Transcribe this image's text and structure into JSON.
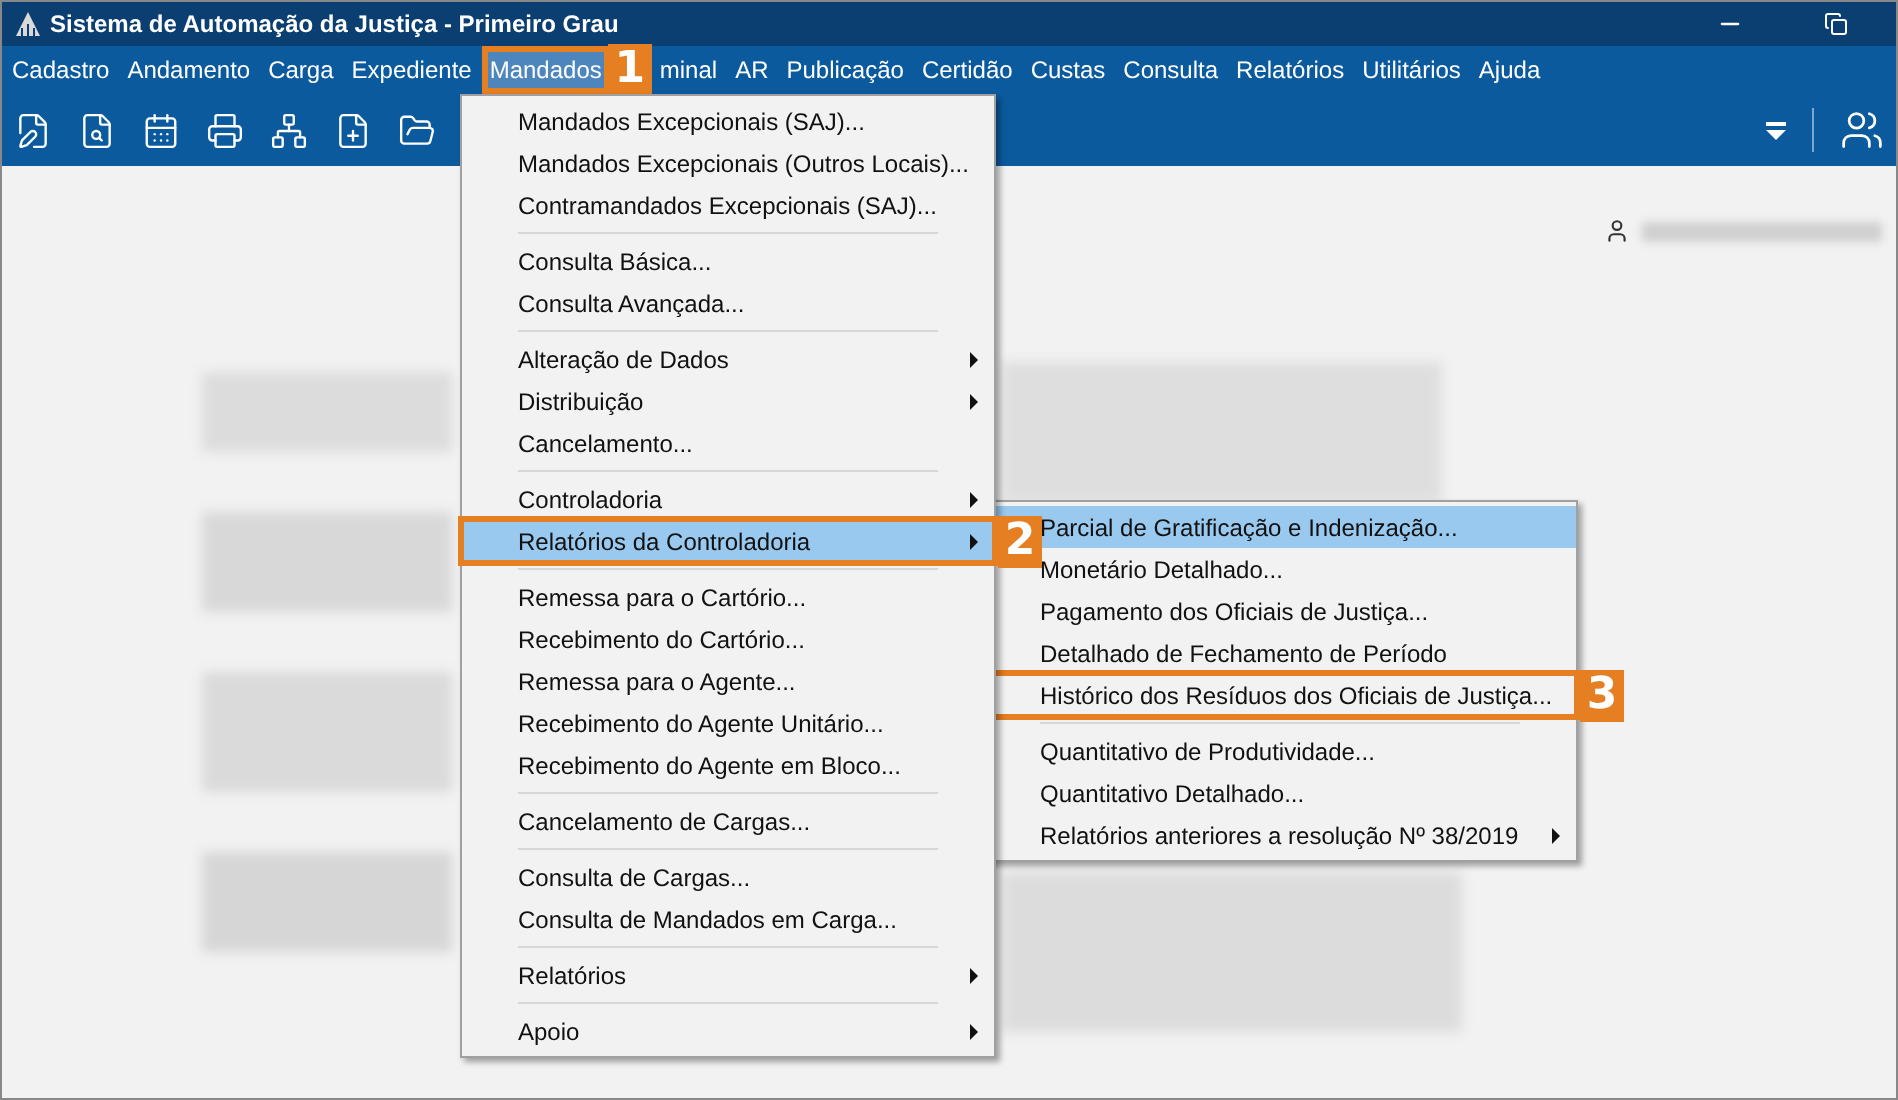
{
  "window": {
    "title": "Sistema de Automação da Justiça - Primeiro Grau"
  },
  "menu_bar": [
    {
      "label": "Cadastro",
      "selected": false
    },
    {
      "label": "Andamento",
      "selected": false
    },
    {
      "label": "Carga",
      "selected": false
    },
    {
      "label": "Expediente",
      "selected": false
    },
    {
      "label": "Mandados",
      "selected": true,
      "callout": "1"
    },
    {
      "label": "minal",
      "selected": false
    },
    {
      "label": "AR",
      "selected": false
    },
    {
      "label": "Publicação",
      "selected": false
    },
    {
      "label": "Certidão",
      "selected": false
    },
    {
      "label": "Custas",
      "selected": false
    },
    {
      "label": "Consulta",
      "selected": false
    },
    {
      "label": "Relatórios",
      "selected": false
    },
    {
      "label": "Utilitários",
      "selected": false
    },
    {
      "label": "Ajuda",
      "selected": false
    }
  ],
  "dropdown": [
    [
      {
        "label": "Mandados Excepcionais (SAJ)...",
        "submenu": false,
        "selected": false
      },
      {
        "label": "Mandados Excepcionais (Outros Locais)...",
        "submenu": false,
        "selected": false
      },
      {
        "label": "Contramandados Excepcionais (SAJ)...",
        "submenu": false,
        "selected": false
      }
    ],
    [
      {
        "label": "Consulta Básica...",
        "submenu": false,
        "selected": false
      },
      {
        "label": "Consulta Avançada...",
        "submenu": false,
        "selected": false
      }
    ],
    [
      {
        "label": "Alteração de Dados",
        "submenu": true,
        "selected": false
      },
      {
        "label": "Distribuição",
        "submenu": true,
        "selected": false
      },
      {
        "label": "Cancelamento...",
        "submenu": false,
        "selected": false
      }
    ],
    [
      {
        "label": "Controladoria",
        "submenu": true,
        "selected": false
      },
      {
        "label": "Relatórios da Controladoria",
        "submenu": true,
        "selected": true,
        "callout": "2"
      }
    ],
    [
      {
        "label": "Remessa para o Cartório...",
        "submenu": false,
        "selected": false
      },
      {
        "label": "Recebimento do Cartório...",
        "submenu": false,
        "selected": false
      },
      {
        "label": "Remessa para o Agente...",
        "submenu": false,
        "selected": false
      },
      {
        "label": "Recebimento do Agente Unitário...",
        "submenu": false,
        "selected": false
      },
      {
        "label": "Recebimento do Agente em Bloco...",
        "submenu": false,
        "selected": false
      }
    ],
    [
      {
        "label": "Cancelamento de Cargas...",
        "submenu": false,
        "selected": false
      }
    ],
    [
      {
        "label": "Consulta de Cargas...",
        "submenu": false,
        "selected": false
      },
      {
        "label": "Consulta de Mandados em Carga...",
        "submenu": false,
        "selected": false
      }
    ],
    [
      {
        "label": "Relatórios",
        "submenu": true,
        "selected": false
      }
    ],
    [
      {
        "label": "Apoio",
        "submenu": true,
        "selected": false
      }
    ]
  ],
  "submenu": [
    [
      {
        "label": "Parcial de Gratificação e Indenização...",
        "submenu": false,
        "selected": true
      },
      {
        "label": "Monetário Detalhado...",
        "submenu": false,
        "selected": false
      },
      {
        "label": "Pagamento dos Oficiais de Justiça...",
        "submenu": false,
        "selected": false
      },
      {
        "label": "Detalhado de Fechamento de Período",
        "submenu": false,
        "selected": false
      },
      {
        "label": "Histórico dos Resíduos dos Oficiais de Justiça...",
        "submenu": false,
        "selected": false,
        "callout": "3"
      }
    ],
    [
      {
        "label": "Quantitativo de Produtividade...",
        "submenu": false,
        "selected": false
      },
      {
        "label": "Quantitativo Detalhado...",
        "submenu": false,
        "selected": false
      },
      {
        "label": "Relatórios anteriores a resolução Nº 38/2019",
        "submenu": true,
        "selected": false
      }
    ]
  ]
}
